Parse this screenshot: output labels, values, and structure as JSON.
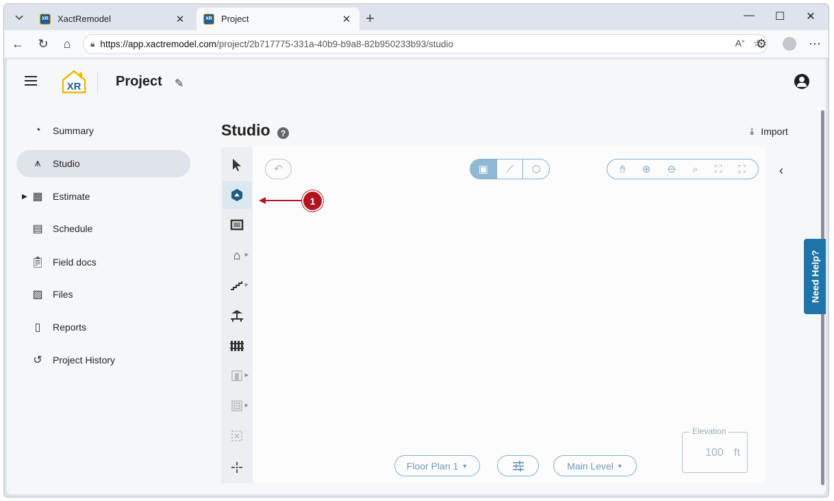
{
  "browser": {
    "tabs": [
      {
        "title": "XactRemodel",
        "favicon": "XR"
      },
      {
        "title": "Project",
        "favicon": "XR"
      }
    ],
    "url_host": "https://app.xactremodel.com",
    "url_path": "/project/2b717775-331a-40b9-b9a8-82b950233b93/studio"
  },
  "header": {
    "logo_text": "XR",
    "project_title": "Project"
  },
  "sidebar": {
    "items": [
      {
        "label": "Summary",
        "icon": "gauge-icon"
      },
      {
        "label": "Studio",
        "icon": "compass-icon",
        "selected": true
      },
      {
        "label": "Estimate",
        "icon": "calculator-icon",
        "expandable": true
      },
      {
        "label": "Schedule",
        "icon": "calendar-icon"
      },
      {
        "label": "Field docs",
        "icon": "clipboard-add-icon"
      },
      {
        "label": "Files",
        "icon": "images-icon"
      },
      {
        "label": "Reports",
        "icon": "document-icon"
      },
      {
        "label": "Project History",
        "icon": "history-icon"
      }
    ]
  },
  "studio": {
    "title": "Studio",
    "help": "?",
    "import_label": "Import",
    "tools": [
      {
        "name": "select-tool",
        "icon": "pointer-icon"
      },
      {
        "name": "room-tool",
        "icon": "room-cube-icon",
        "selected": true
      },
      {
        "name": "wall-tool",
        "icon": "wall-icon"
      },
      {
        "name": "roof-tool",
        "icon": "house-icon"
      },
      {
        "name": "stairs-tool",
        "icon": "stairs-icon"
      },
      {
        "name": "deck-tool",
        "icon": "deck-icon"
      },
      {
        "name": "fence-tool",
        "icon": "fence-icon"
      },
      {
        "name": "door-tool",
        "icon": "door-icon",
        "disabled": true
      },
      {
        "name": "window-tool",
        "icon": "window-icon",
        "disabled": true
      },
      {
        "name": "opening-tool",
        "icon": "opening-icon",
        "disabled": true
      },
      {
        "name": "point-tool",
        "icon": "crosshair-icon"
      }
    ],
    "floor_plan_label": "Floor Plan 1",
    "level_label": "Main Level",
    "elevation": {
      "label": "Elevation",
      "value": "100",
      "unit": "ft"
    }
  },
  "callout": {
    "number": "1",
    "color": "#b3131f"
  },
  "help_widget": {
    "label": "Need Help?",
    "color": "#1e73a8"
  },
  "colors": {
    "accent": "#7fb0cf",
    "selected_nav": "#dfe3ea"
  }
}
